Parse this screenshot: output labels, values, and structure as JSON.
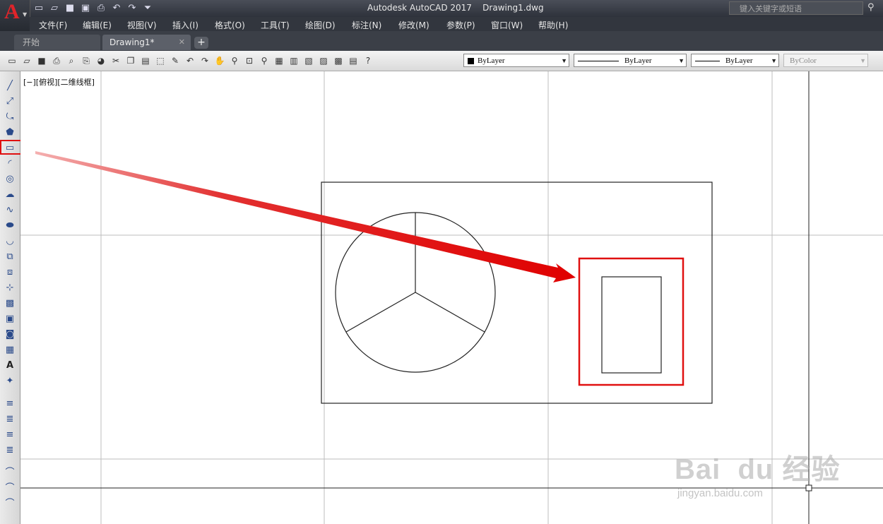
{
  "window": {
    "title": "Autodesk AutoCAD 2017    Drawing1.dwg",
    "search_placeholder": "键入关键字或短语",
    "app_letter": "A"
  },
  "menu": [
    "文件(F)",
    "编辑(E)",
    "视图(V)",
    "插入(I)",
    "格式(O)",
    "工具(T)",
    "绘图(D)",
    "标注(N)",
    "修改(M)",
    "参数(P)",
    "窗口(W)",
    "帮助(H)"
  ],
  "tabs": [
    {
      "label": "开始"
    },
    {
      "label": "Drawing1*"
    }
  ],
  "tab_plus": "+",
  "properties": {
    "color": "ByLayer",
    "linetype": "ByLayer",
    "lineweight": "ByLayer",
    "plotstyle": "ByColor"
  },
  "viewport": {
    "label": "[−][俯视][二维线框]"
  },
  "watermark": {
    "main": "Bai  du 经验",
    "sub": "jingyan.baidu.com"
  },
  "colors": {
    "highlight": "#e01010",
    "canvas": "#ffffff",
    "grid": "#bbbbbb"
  }
}
